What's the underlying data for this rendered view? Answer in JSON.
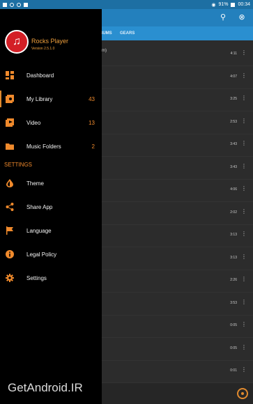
{
  "statusbar": {
    "battery": "91%",
    "time": "00:34"
  },
  "background_app": {
    "tabs": [
      "ALBUMS",
      "GEARS"
    ],
    "visible_fragment": "m)",
    "durations": [
      "4:11",
      "4:07",
      "3:25",
      "2:53",
      "3:43",
      "3:43",
      "4:06",
      "2:02",
      "3:13",
      "3:13",
      "2:26",
      "3:53",
      "0:05",
      "0:05",
      "0:01"
    ]
  },
  "drawer": {
    "app_name": "Rocks Player",
    "version": "Version 2.5.1.0",
    "items": [
      {
        "label": "Dashboard",
        "icon": "dashboard-icon",
        "count": ""
      },
      {
        "label": "My Library",
        "icon": "library-icon",
        "count": "43"
      },
      {
        "label": "Video",
        "icon": "video-icon",
        "count": "13"
      },
      {
        "label": "Music Folders",
        "icon": "folder-icon",
        "count": "2"
      }
    ],
    "settings_heading": "SETTINGS",
    "settings_items": [
      {
        "label": "Theme",
        "icon": "theme-icon"
      },
      {
        "label": "Share App",
        "icon": "share-icon"
      },
      {
        "label": "Language",
        "icon": "flag-icon"
      },
      {
        "label": "Legal Policy",
        "icon": "info-icon"
      },
      {
        "label": "Settings",
        "icon": "gear-icon"
      }
    ]
  },
  "watermark": "GetAndroid.IR",
  "colors": {
    "accent": "#f08a2c",
    "appbar": "#2380bd",
    "drawer_bg": "#000000"
  }
}
